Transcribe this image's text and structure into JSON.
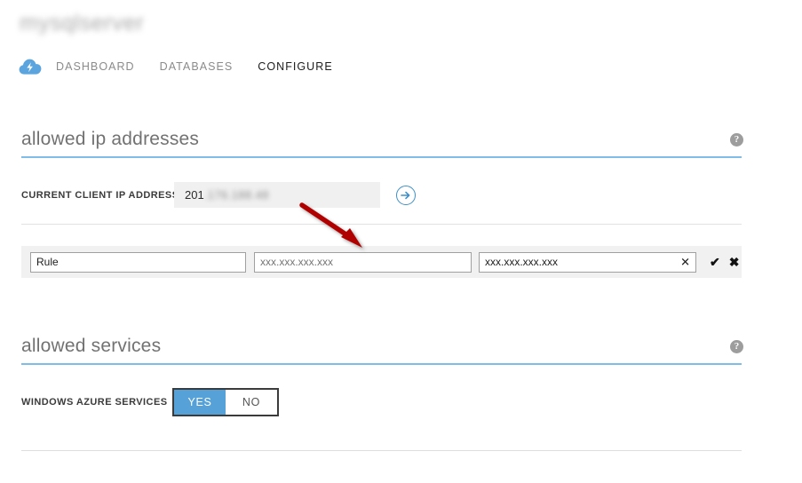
{
  "header": {
    "title_redacted": "mysqlserver",
    "service_icon": "azure-cloud-icon",
    "tabs": [
      {
        "label": "DASHBOARD",
        "active": false
      },
      {
        "label": "DATABASES",
        "active": false
      },
      {
        "label": "CONFIGURE",
        "active": true
      }
    ]
  },
  "sections": {
    "allowed_ip": {
      "heading": "allowed ip addresses",
      "help_glyph": "?",
      "current_ip": {
        "label": "CURRENT CLIENT IP ADDRESS",
        "value_visible": "201",
        "value_redacted": ".176.188.48",
        "add_button_glyph": "→"
      },
      "rule_row": {
        "rule_name": "Rule",
        "start_ip_placeholder": "xxx.xxx.xxx.xxx",
        "start_ip_value": "",
        "end_ip_value": "xxx.xxx.xxx.xxx",
        "clear_glyph": "✕",
        "confirm_glyph": "✔",
        "cancel_glyph": "✖"
      }
    },
    "allowed_services": {
      "heading": "allowed services",
      "help_glyph": "?",
      "windows_azure_services": {
        "label": "WINDOWS AZURE SERVICES",
        "options": [
          {
            "label": "YES",
            "selected": true
          },
          {
            "label": "NO",
            "selected": false
          }
        ]
      }
    }
  },
  "annotation": {
    "type": "arrow",
    "color": "#b00000",
    "points_to": "start-ip-input"
  },
  "colors": {
    "accent_blue": "#56a2d8",
    "rule_blue": "#7fbce8",
    "row_gray": "#f1f1f1",
    "readonly_gray": "#f0f0f0",
    "annotation_red": "#b00000"
  }
}
